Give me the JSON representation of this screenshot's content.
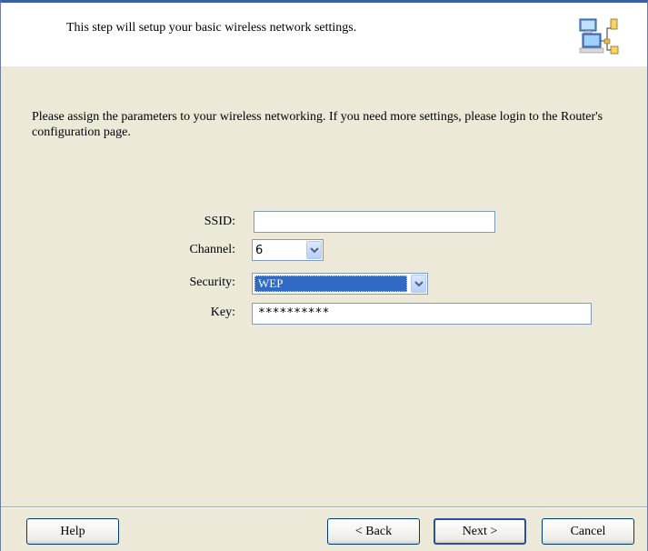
{
  "header": {
    "text": "This step will setup your basic wireless network settings.",
    "icon": "network-computers-icon"
  },
  "intro": "Please assign the parameters to your wireless networking. If you need more settings, please login to the Router's configuration page.",
  "form": {
    "ssid_label": "SSID:",
    "ssid_value": "",
    "channel_label": "Channel:",
    "channel_value": "6",
    "security_label": "Security:",
    "security_value": "WEP",
    "key_label": "Key:",
    "key_value": "**********"
  },
  "buttons": {
    "help": "Help",
    "back": "< Back",
    "next": "Next >",
    "cancel": "Cancel"
  },
  "colors": {
    "dialog_bg": "#ece9d8",
    "selection": "#316ac5",
    "title_border": "#3a5fa8"
  }
}
